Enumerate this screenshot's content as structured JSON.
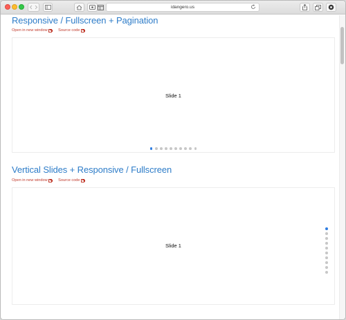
{
  "browser": {
    "address": "idangero.us",
    "icons": [
      "sidebar-icon",
      "home-icon",
      "media-icon",
      "layout-icon",
      "reload-icon",
      "share-icon",
      "tabs-icon",
      "settings-icon"
    ]
  },
  "sections": [
    {
      "title": "Responsive / Fullscreen + Pagination",
      "links": {
        "open": "Open in new window",
        "source": "Source code"
      },
      "slide_label": "Slide 1",
      "pagination": {
        "orientation": "horizontal",
        "count": 10,
        "active_index": 0
      }
    },
    {
      "title": "Vertical Slides + Responsive / Fullscreen",
      "links": {
        "open": "Open in new window",
        "source": "Source code"
      },
      "slide_label": "Slide 1",
      "pagination": {
        "orientation": "vertical",
        "count": 10,
        "active_index": 0
      }
    }
  ],
  "colors": {
    "title": "#2d7cc8",
    "link": "#c0392b",
    "active_dot": "#2f7de1",
    "inactive_dot": "#c7c7c7"
  }
}
